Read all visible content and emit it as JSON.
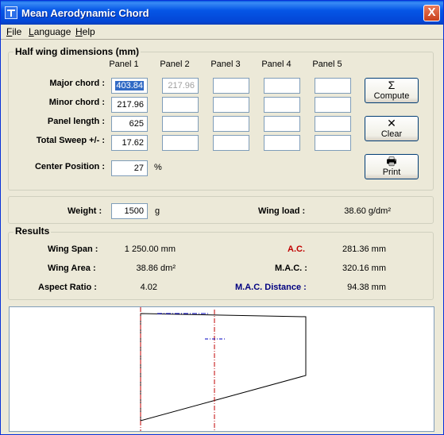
{
  "window": {
    "title": "Mean Aerodynamic Chord",
    "close_label": "X"
  },
  "menu": [
    {
      "underline": "F",
      "rest": "ile"
    },
    {
      "underline": "L",
      "rest": "anguage"
    },
    {
      "underline": "H",
      "rest": "elp"
    }
  ],
  "dimensions": {
    "title": "Half wing dimensions (mm)",
    "panels": [
      "Panel 1",
      "Panel 2",
      "Panel 3",
      "Panel 4",
      "Panel 5"
    ],
    "rows": [
      {
        "label": "Major chord :",
        "values": [
          "403.84",
          "217.96",
          "",
          "",
          ""
        ]
      },
      {
        "label": "Minor chord :",
        "values": [
          "217.96",
          "",
          "",
          "",
          ""
        ]
      },
      {
        "label": "Panel length :",
        "values": [
          "625",
          "",
          "",
          "",
          ""
        ]
      },
      {
        "label": "Total Sweep +/- :",
        "values": [
          "17.62",
          "",
          "",
          "",
          ""
        ]
      }
    ],
    "center_position": {
      "label": "Center Position :",
      "value": "27",
      "unit": "%"
    }
  },
  "buttons": {
    "compute": {
      "icon": "Σ",
      "label": "Compute",
      "accel": "C"
    },
    "clear": {
      "icon": "✕",
      "label": "Clear",
      "accel": "C"
    },
    "print": {
      "icon": "🖶",
      "label": "Print",
      "accel": "P"
    }
  },
  "weight": {
    "label": "Weight :",
    "value": "1500",
    "unit": "g",
    "wing_load_label": "Wing load :",
    "wing_load_value": "38.60 g/dm²"
  },
  "results": {
    "title": "Results",
    "wing_span_label": "Wing Span :",
    "wing_span_value": "1 250.00 mm",
    "wing_area_label": "Wing Area :",
    "wing_area_value": "38.86 dm²",
    "aspect_ratio_label": "Aspect Ratio :",
    "aspect_ratio_value": "4.02",
    "ac_label": "A.C.",
    "ac_value": "281.36 mm",
    "mac_label": "M.A.C. :",
    "mac_value": "320.16 mm",
    "mac_distance_label": "M.A.C. Distance :",
    "mac_distance_value": "94.38 mm"
  },
  "colors": {
    "ac_label": "#c00000",
    "mac_distance_label": "#000080",
    "centerline": "#c00000",
    "mac_line": "#0000c0"
  }
}
